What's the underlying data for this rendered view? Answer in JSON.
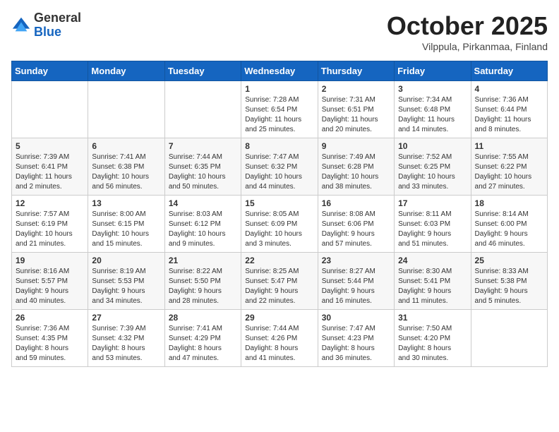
{
  "header": {
    "logo_general": "General",
    "logo_blue": "Blue",
    "month_title": "October 2025",
    "location": "Vilppula, Pirkanmaa, Finland"
  },
  "days_of_week": [
    "Sunday",
    "Monday",
    "Tuesday",
    "Wednesday",
    "Thursday",
    "Friday",
    "Saturday"
  ],
  "weeks": [
    [
      {
        "day": "",
        "info": ""
      },
      {
        "day": "",
        "info": ""
      },
      {
        "day": "",
        "info": ""
      },
      {
        "day": "1",
        "info": "Sunrise: 7:28 AM\nSunset: 6:54 PM\nDaylight: 11 hours\nand 25 minutes."
      },
      {
        "day": "2",
        "info": "Sunrise: 7:31 AM\nSunset: 6:51 PM\nDaylight: 11 hours\nand 20 minutes."
      },
      {
        "day": "3",
        "info": "Sunrise: 7:34 AM\nSunset: 6:48 PM\nDaylight: 11 hours\nand 14 minutes."
      },
      {
        "day": "4",
        "info": "Sunrise: 7:36 AM\nSunset: 6:44 PM\nDaylight: 11 hours\nand 8 minutes."
      }
    ],
    [
      {
        "day": "5",
        "info": "Sunrise: 7:39 AM\nSunset: 6:41 PM\nDaylight: 11 hours\nand 2 minutes."
      },
      {
        "day": "6",
        "info": "Sunrise: 7:41 AM\nSunset: 6:38 PM\nDaylight: 10 hours\nand 56 minutes."
      },
      {
        "day": "7",
        "info": "Sunrise: 7:44 AM\nSunset: 6:35 PM\nDaylight: 10 hours\nand 50 minutes."
      },
      {
        "day": "8",
        "info": "Sunrise: 7:47 AM\nSunset: 6:32 PM\nDaylight: 10 hours\nand 44 minutes."
      },
      {
        "day": "9",
        "info": "Sunrise: 7:49 AM\nSunset: 6:28 PM\nDaylight: 10 hours\nand 38 minutes."
      },
      {
        "day": "10",
        "info": "Sunrise: 7:52 AM\nSunset: 6:25 PM\nDaylight: 10 hours\nand 33 minutes."
      },
      {
        "day": "11",
        "info": "Sunrise: 7:55 AM\nSunset: 6:22 PM\nDaylight: 10 hours\nand 27 minutes."
      }
    ],
    [
      {
        "day": "12",
        "info": "Sunrise: 7:57 AM\nSunset: 6:19 PM\nDaylight: 10 hours\nand 21 minutes."
      },
      {
        "day": "13",
        "info": "Sunrise: 8:00 AM\nSunset: 6:15 PM\nDaylight: 10 hours\nand 15 minutes."
      },
      {
        "day": "14",
        "info": "Sunrise: 8:03 AM\nSunset: 6:12 PM\nDaylight: 10 hours\nand 9 minutes."
      },
      {
        "day": "15",
        "info": "Sunrise: 8:05 AM\nSunset: 6:09 PM\nDaylight: 10 hours\nand 3 minutes."
      },
      {
        "day": "16",
        "info": "Sunrise: 8:08 AM\nSunset: 6:06 PM\nDaylight: 9 hours\nand 57 minutes."
      },
      {
        "day": "17",
        "info": "Sunrise: 8:11 AM\nSunset: 6:03 PM\nDaylight: 9 hours\nand 51 minutes."
      },
      {
        "day": "18",
        "info": "Sunrise: 8:14 AM\nSunset: 6:00 PM\nDaylight: 9 hours\nand 46 minutes."
      }
    ],
    [
      {
        "day": "19",
        "info": "Sunrise: 8:16 AM\nSunset: 5:57 PM\nDaylight: 9 hours\nand 40 minutes."
      },
      {
        "day": "20",
        "info": "Sunrise: 8:19 AM\nSunset: 5:53 PM\nDaylight: 9 hours\nand 34 minutes."
      },
      {
        "day": "21",
        "info": "Sunrise: 8:22 AM\nSunset: 5:50 PM\nDaylight: 9 hours\nand 28 minutes."
      },
      {
        "day": "22",
        "info": "Sunrise: 8:25 AM\nSunset: 5:47 PM\nDaylight: 9 hours\nand 22 minutes."
      },
      {
        "day": "23",
        "info": "Sunrise: 8:27 AM\nSunset: 5:44 PM\nDaylight: 9 hours\nand 16 minutes."
      },
      {
        "day": "24",
        "info": "Sunrise: 8:30 AM\nSunset: 5:41 PM\nDaylight: 9 hours\nand 11 minutes."
      },
      {
        "day": "25",
        "info": "Sunrise: 8:33 AM\nSunset: 5:38 PM\nDaylight: 9 hours\nand 5 minutes."
      }
    ],
    [
      {
        "day": "26",
        "info": "Sunrise: 7:36 AM\nSunset: 4:35 PM\nDaylight: 8 hours\nand 59 minutes."
      },
      {
        "day": "27",
        "info": "Sunrise: 7:39 AM\nSunset: 4:32 PM\nDaylight: 8 hours\nand 53 minutes."
      },
      {
        "day": "28",
        "info": "Sunrise: 7:41 AM\nSunset: 4:29 PM\nDaylight: 8 hours\nand 47 minutes."
      },
      {
        "day": "29",
        "info": "Sunrise: 7:44 AM\nSunset: 4:26 PM\nDaylight: 8 hours\nand 41 minutes."
      },
      {
        "day": "30",
        "info": "Sunrise: 7:47 AM\nSunset: 4:23 PM\nDaylight: 8 hours\nand 36 minutes."
      },
      {
        "day": "31",
        "info": "Sunrise: 7:50 AM\nSunset: 4:20 PM\nDaylight: 8 hours\nand 30 minutes."
      },
      {
        "day": "",
        "info": ""
      }
    ]
  ]
}
